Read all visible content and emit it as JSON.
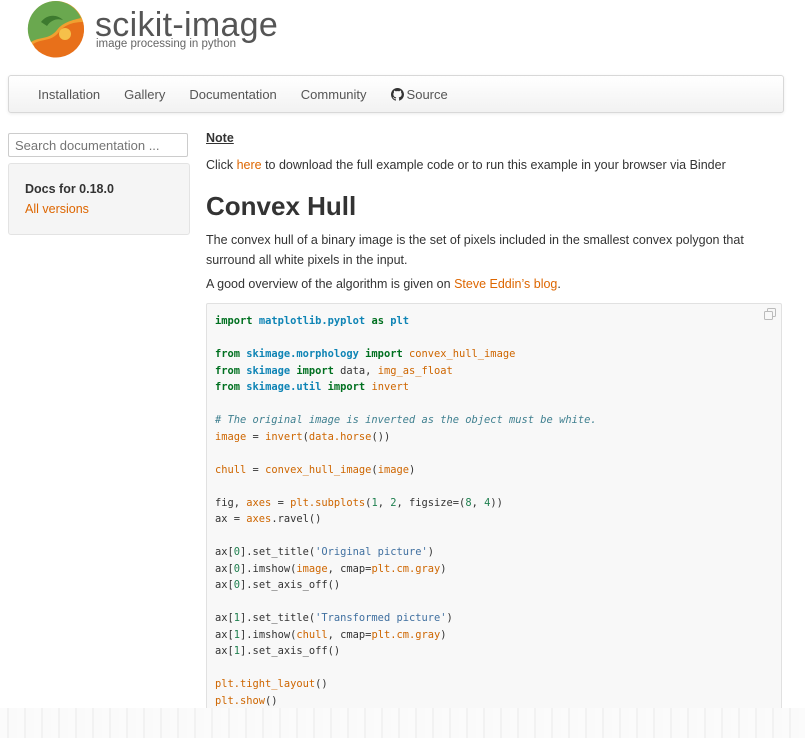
{
  "header": {
    "brand_title": "scikit-image",
    "brand_subtitle": "image processing in python"
  },
  "nav": {
    "items": [
      "Installation",
      "Gallery",
      "Documentation",
      "Community",
      "Source"
    ]
  },
  "sidebar": {
    "search_placeholder": "Search documentation ...",
    "docs_version": "Docs for 0.18.0",
    "all_versions": "All versions"
  },
  "main": {
    "note_title": "Note",
    "note_prefix": "Click ",
    "note_link": "here",
    "note_suffix": " to download the full example code or to run this example in your browser via Binder",
    "title": "Convex Hull",
    "para1": "The convex hull of a binary image is the set of pixels included in the smallest convex polygon that surround all white pixels in the input.",
    "para2_prefix": "A good overview of the algorithm is given on ",
    "para2_link": "Steve Eddin’s blog",
    "para2_suffix": "."
  },
  "code": {
    "lines": [
      [
        [
          "kw",
          "import"
        ],
        [
          "t",
          " "
        ],
        [
          "mod",
          "matplotlib.pyplot"
        ],
        [
          "t",
          " "
        ],
        [
          "kw",
          "as"
        ],
        [
          "t",
          " "
        ],
        [
          "mod",
          "plt"
        ]
      ],
      [],
      [
        [
          "kw",
          "from"
        ],
        [
          "t",
          " "
        ],
        [
          "mod",
          "skimage.morphology"
        ],
        [
          "t",
          " "
        ],
        [
          "kw",
          "import"
        ],
        [
          "t",
          " "
        ],
        [
          "nm",
          "convex_hull_image"
        ]
      ],
      [
        [
          "kw",
          "from"
        ],
        [
          "t",
          " "
        ],
        [
          "mod",
          "skimage"
        ],
        [
          "t",
          " "
        ],
        [
          "kw",
          "import"
        ],
        [
          "t",
          " data, "
        ],
        [
          "nm",
          "img_as_float"
        ]
      ],
      [
        [
          "kw",
          "from"
        ],
        [
          "t",
          " "
        ],
        [
          "mod",
          "skimage.util"
        ],
        [
          "t",
          " "
        ],
        [
          "kw",
          "import"
        ],
        [
          "t",
          " "
        ],
        [
          "nm",
          "invert"
        ]
      ],
      [],
      [
        [
          "cm",
          "# The original image is inverted as the object must be white."
        ]
      ],
      [
        [
          "nm",
          "image"
        ],
        [
          "t",
          " = "
        ],
        [
          "nm",
          "invert"
        ],
        [
          "t",
          "("
        ],
        [
          "nm",
          "data.horse"
        ],
        [
          "t",
          "())"
        ]
      ],
      [],
      [
        [
          "nm",
          "chull"
        ],
        [
          "t",
          " = "
        ],
        [
          "nm",
          "convex_hull_image"
        ],
        [
          "t",
          "("
        ],
        [
          "nm",
          "image"
        ],
        [
          "t",
          ")"
        ]
      ],
      [],
      [
        [
          "t",
          "fig, "
        ],
        [
          "nm",
          "axes"
        ],
        [
          "t",
          " = "
        ],
        [
          "nm",
          "plt.subplots"
        ],
        [
          "t",
          "("
        ],
        [
          "num",
          "1"
        ],
        [
          "t",
          ", "
        ],
        [
          "num",
          "2"
        ],
        [
          "t",
          ", figsize=("
        ],
        [
          "num",
          "8"
        ],
        [
          "t",
          ", "
        ],
        [
          "num",
          "4"
        ],
        [
          "t",
          "))"
        ]
      ],
      [
        [
          "t",
          "ax = "
        ],
        [
          "nm",
          "axes"
        ],
        [
          "t",
          ".ravel()"
        ]
      ],
      [],
      [
        [
          "t",
          "ax["
        ],
        [
          "num",
          "0"
        ],
        [
          "t",
          "].set_title("
        ],
        [
          "str",
          "'Original picture'"
        ],
        [
          "t",
          ")"
        ]
      ],
      [
        [
          "t",
          "ax["
        ],
        [
          "num",
          "0"
        ],
        [
          "t",
          "].imshow("
        ],
        [
          "nm",
          "image"
        ],
        [
          "t",
          ", cmap="
        ],
        [
          "nm",
          "plt.cm.gray"
        ],
        [
          "t",
          ")"
        ]
      ],
      [
        [
          "t",
          "ax["
        ],
        [
          "num",
          "0"
        ],
        [
          "t",
          "].set_axis_off()"
        ]
      ],
      [],
      [
        [
          "t",
          "ax["
        ],
        [
          "num",
          "1"
        ],
        [
          "t",
          "].set_title("
        ],
        [
          "str",
          "'Transformed picture'"
        ],
        [
          "t",
          ")"
        ]
      ],
      [
        [
          "t",
          "ax["
        ],
        [
          "num",
          "1"
        ],
        [
          "t",
          "].imshow("
        ],
        [
          "nm",
          "chull"
        ],
        [
          "t",
          ", cmap="
        ],
        [
          "nm",
          "plt.cm.gray"
        ],
        [
          "t",
          ")"
        ]
      ],
      [
        [
          "t",
          "ax["
        ],
        [
          "num",
          "1"
        ],
        [
          "t",
          "].set_axis_off()"
        ]
      ],
      [],
      [
        [
          "nm",
          "plt.tight_layout"
        ],
        [
          "t",
          "()"
        ]
      ],
      [
        [
          "nm",
          "plt.show"
        ],
        [
          "t",
          "()"
        ]
      ]
    ]
  },
  "colors": {
    "link": "#dd6600",
    "keyword": "#007020",
    "module": "#0e84b5",
    "name": "#ce6600",
    "string": "#4070a0",
    "number": "#208050",
    "comment": "#408090"
  },
  "icons": [
    "scikit-image-logo",
    "github-icon",
    "copy-icon"
  ]
}
